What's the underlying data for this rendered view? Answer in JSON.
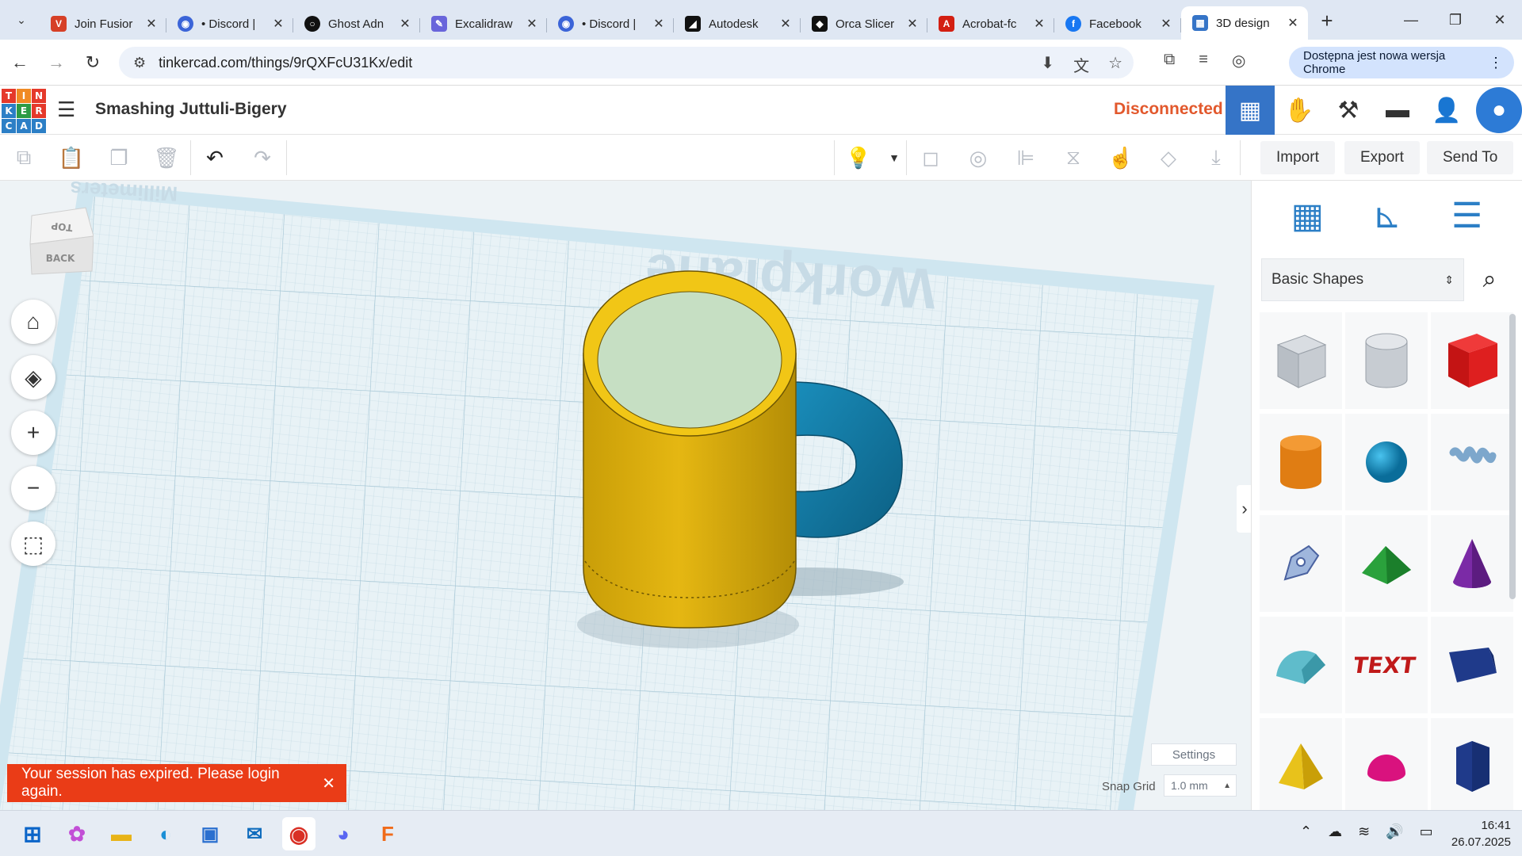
{
  "browser": {
    "tabs": [
      {
        "title": "Join Fusior",
        "icon": "fusion-icon",
        "color": "#d64027"
      },
      {
        "title": "• Discord |",
        "icon": "discord-icon",
        "color": "#3b64d8"
      },
      {
        "title": "Ghost Adn",
        "icon": "ghost-icon",
        "color": "#111111"
      },
      {
        "title": "Excalidraw",
        "icon": "excalidraw-icon",
        "color": "#6965db"
      },
      {
        "title": "• Discord |",
        "icon": "discord-icon",
        "color": "#3b64d8"
      },
      {
        "title": "Autodesk",
        "icon": "autodesk-icon",
        "color": "#111111"
      },
      {
        "title": "Orca Slicer",
        "icon": "orca-icon",
        "color": "#111111"
      },
      {
        "title": "Acrobat-fc",
        "icon": "acrobat-icon",
        "color": "#d31f12"
      },
      {
        "title": "Facebook",
        "icon": "facebook-icon",
        "color": "#1877f2"
      },
      {
        "title": "3D design",
        "icon": "tinkercad-icon",
        "color": "#3574c7"
      }
    ],
    "url": "tinkercad.com/things/9rQXFcU31Kx/edit",
    "update_label": "Dostępna jest nowa wersja Chrome"
  },
  "tinkercad": {
    "logo_letters": [
      "T",
      "I",
      "N",
      "K",
      "E",
      "R",
      "C",
      "A",
      "D"
    ],
    "design_title": "Smashing Juttuli-Bigery",
    "status": "Disconnected",
    "toolbar": {
      "import_label": "Import",
      "export_label": "Export",
      "send_label": "Send To"
    },
    "viewport": {
      "workplane_label": "Workplane",
      "units_label": "Millimeters",
      "navcube_top": "TOP",
      "navcube_back": "BACK",
      "settings_label": "Settings",
      "snap_grid_label": "Snap Grid",
      "snap_grid_value": "1.0 mm"
    },
    "panel": {
      "category": "Basic Shapes",
      "text_shape_label": "TEXT"
    },
    "toast": "Your session has expired. Please login again."
  },
  "taskbar": {
    "time": "16:41",
    "date": "26.07.2025"
  },
  "colors": {
    "mug_body": "#e5b712",
    "mug_handle": "#137ea8",
    "workplane": "#cfe6f0",
    "status": "#e2582c",
    "toast": "#ea3c17"
  }
}
